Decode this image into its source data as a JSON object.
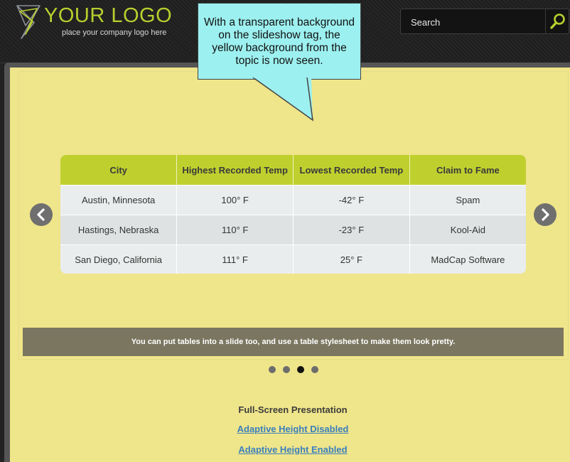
{
  "header": {
    "logo_title": "YOUR LOGO",
    "logo_tagline": "place your company logo here",
    "search_placeholder": "Search"
  },
  "callout": {
    "text": "With a transparent background on the slideshow tag, the yellow background from the topic is now seen."
  },
  "table": {
    "headers": [
      "City",
      "Highest Recorded Temp",
      "Lowest Recorded Temp",
      "Claim to Fame"
    ],
    "rows": [
      [
        "Austin, Minnesota",
        "100° F",
        "-42° F",
        "Spam"
      ],
      [
        "Hastings, Nebraska",
        "110° F",
        "-23° F",
        "Kool-Aid"
      ],
      [
        "San Diego, California",
        "111° F",
        "25° F",
        "MadCap Software"
      ]
    ]
  },
  "slide_caption": "You can put tables into a slide too, and use a table stylesheet to make them look pretty.",
  "slideshow": {
    "slide_count": 4,
    "active_slide": 3
  },
  "links": {
    "heading": "Full-Screen Presentation",
    "items": [
      "Adaptive Height Disabled",
      "Adaptive Height Enabled"
    ]
  },
  "colors": {
    "accent": "#bfd02e",
    "page_background": "#efe58a",
    "callout_background": "#9df0f0",
    "caption_background": "#7b7660",
    "link": "#3a7fbd"
  },
  "icons": [
    "logo-mark-icon",
    "magnifier-icon",
    "chevron-left-icon",
    "chevron-right-icon"
  ]
}
